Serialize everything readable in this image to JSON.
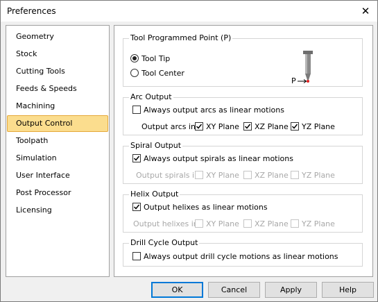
{
  "window": {
    "title": "Preferences"
  },
  "sidebar": {
    "items": [
      {
        "label": "Geometry"
      },
      {
        "label": "Stock"
      },
      {
        "label": "Cutting Tools"
      },
      {
        "label": "Feeds & Speeds"
      },
      {
        "label": "Machining"
      },
      {
        "label": "Output Control"
      },
      {
        "label": "Toolpath"
      },
      {
        "label": "Simulation"
      },
      {
        "label": "User Interface"
      },
      {
        "label": "Post Processor"
      },
      {
        "label": "Licensing"
      }
    ],
    "selected": "Output Control"
  },
  "tool_point": {
    "legend": "Tool Programmed Point (P)",
    "options": [
      "Tool Tip",
      "Tool Center"
    ],
    "selected": "Tool Tip",
    "diagram_label": "P",
    "marker_color": "#e02020"
  },
  "arc": {
    "legend": "Arc Output",
    "always_label": "Always output arcs as linear motions",
    "always_checked": false,
    "planes_label": "Output arcs in:",
    "planes": [
      {
        "label": "XY Plane",
        "checked": true
      },
      {
        "label": "XZ Plane",
        "checked": true
      },
      {
        "label": "YZ Plane",
        "checked": true
      }
    ]
  },
  "spiral": {
    "legend": "Spiral Output",
    "always_label": "Always output spirals as linear motions",
    "always_checked": true,
    "planes_label": "Output spirals in:",
    "planes": [
      {
        "label": "XY Plane",
        "checked": false
      },
      {
        "label": "XZ Plane",
        "checked": false
      },
      {
        "label": "YZ Plane",
        "checked": false
      }
    ]
  },
  "helix": {
    "legend": "Helix Output",
    "always_label": "Output helixes as linear motions",
    "always_checked": true,
    "planes_label": "Output helixes in:",
    "planes": [
      {
        "label": "XY Plane",
        "checked": false
      },
      {
        "label": "XZ Plane",
        "checked": false
      },
      {
        "label": "YZ Plane",
        "checked": false
      }
    ]
  },
  "drill": {
    "legend": "Drill Cycle Output",
    "always_label": "Always output drill cycle motions as linear motions",
    "always_checked": false
  },
  "buttons": {
    "ok": "OK",
    "cancel": "Cancel",
    "apply": "Apply",
    "help": "Help"
  },
  "colors": {
    "selection_fill": "#fbdd8e",
    "selection_border": "#e5a83a",
    "default_button_border": "#0078d7"
  }
}
